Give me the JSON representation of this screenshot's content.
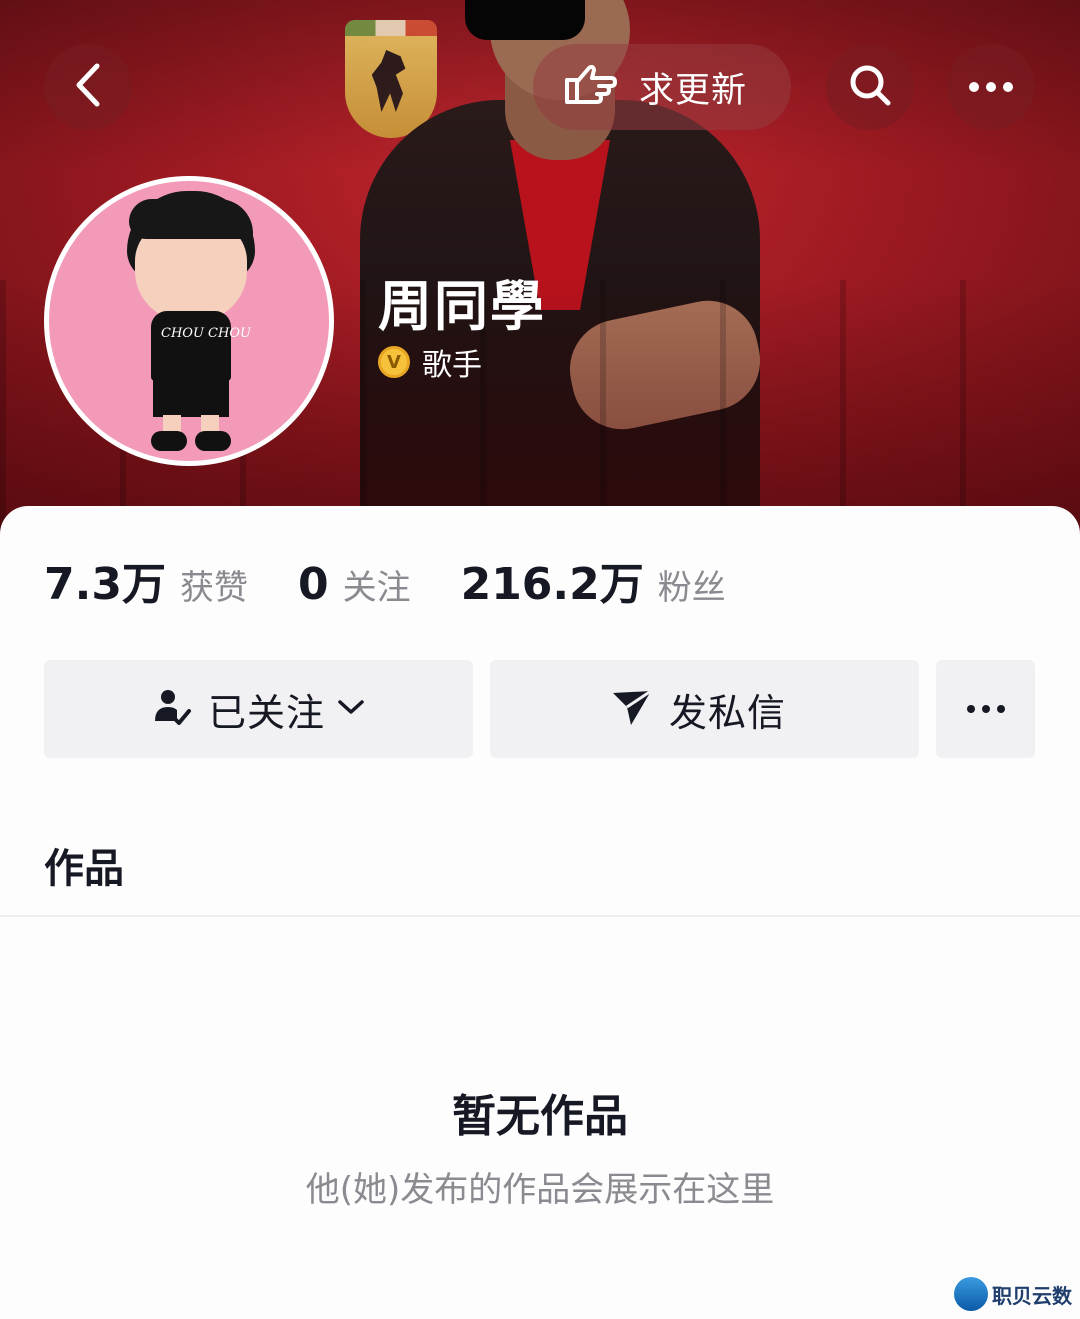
{
  "header": {
    "update_label": "求更新"
  },
  "profile": {
    "name": "周同學",
    "verified_title": "歌手",
    "verified_badge": "V",
    "avatar_shirt_text": "CHOU CHOU"
  },
  "stats": [
    {
      "value": "7.3万",
      "label": "获赞"
    },
    {
      "value": "0",
      "label": "关注"
    },
    {
      "value": "216.2万",
      "label": "粉丝"
    }
  ],
  "actions": {
    "followed_label": "已关注",
    "message_label": "发私信"
  },
  "tabs": {
    "works_label": "作品"
  },
  "empty_state": {
    "title": "暂无作品",
    "subtitle": "他(她)发布的作品会展示在这里"
  },
  "watermark": {
    "text": "职贝云数"
  },
  "colors": {
    "banner_red": "#9e1a22",
    "text_primary": "#161823",
    "text_secondary": "#8a8b91",
    "button_bg": "#f1f1f3",
    "verified_gold": "#f7c23b"
  },
  "icons": [
    "back-arrow-icon",
    "pointing-hand-icon",
    "search-icon",
    "more-dots-icon",
    "person-check-icon",
    "chevron-down-icon",
    "send-icon",
    "verified-v-icon"
  ]
}
